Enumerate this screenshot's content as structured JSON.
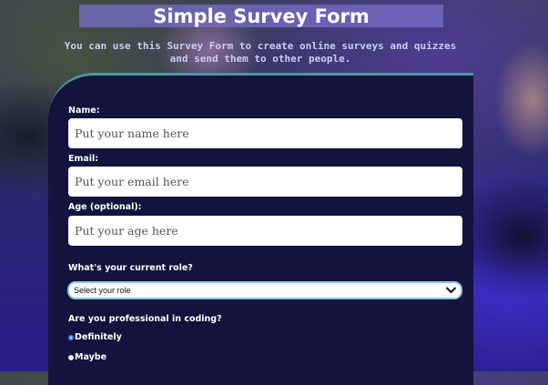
{
  "header": {
    "title": "Simple Survey Form",
    "description": "You can use this Survey Form to create online surveys and quizzes and send them to other people."
  },
  "form": {
    "name": {
      "label": "Name:",
      "placeholder": "Put your name here",
      "value": ""
    },
    "email": {
      "label": "Email:",
      "placeholder": "Put your email here",
      "value": ""
    },
    "age": {
      "label": "Age (optional):",
      "placeholder": "Put your age here",
      "value": ""
    },
    "role": {
      "question": "What's your current role?",
      "selected": "Select your role",
      "icon": "chevron-down-icon"
    },
    "coding": {
      "question": "Are you professional in coding?",
      "options": [
        {
          "label": "Definitely",
          "checked": true
        },
        {
          "label": "Maybe",
          "checked": false
        }
      ]
    }
  },
  "colors": {
    "card_background": "#14133d",
    "card_border": "#4a9a9a",
    "title_bar": "#786ec8",
    "subtitle_text": "#c8cdf6",
    "radio_checked": "#3a8cf0"
  }
}
